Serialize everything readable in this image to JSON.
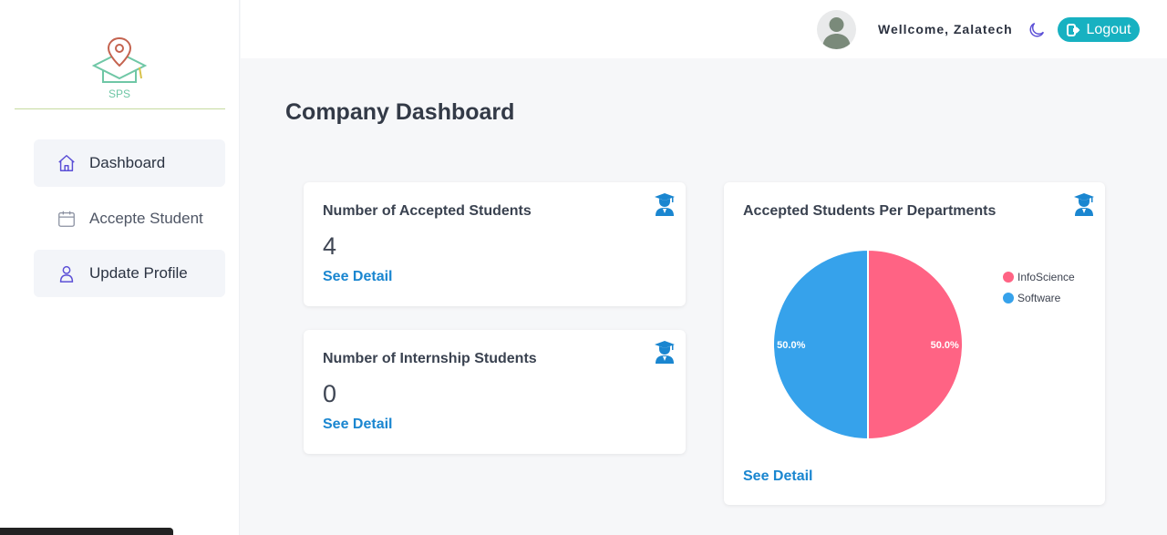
{
  "sidebar": {
    "logo_text": "SPS",
    "items": [
      {
        "label": "Dashboard",
        "icon": "home-icon"
      },
      {
        "label": "Accepte Student",
        "icon": "calendar-icon"
      },
      {
        "label": "Update Profile",
        "icon": "user-icon"
      }
    ]
  },
  "header": {
    "welcome": "Wellcome, Zalatech",
    "logout_label": "Logout",
    "theme_icon": "moon-icon"
  },
  "main": {
    "title": "Company Dashboard",
    "cards": [
      {
        "title": "Number of Accepted Students",
        "value": "4",
        "link": "See Detail",
        "icon": "graduate-icon"
      },
      {
        "title": "Number of Internship Students",
        "value": "0",
        "link": "See Detail",
        "icon": "graduate-icon"
      }
    ],
    "chart_card": {
      "title": "Accepted Students Per Departments",
      "link": "See Detail",
      "icon": "graduate-icon"
    }
  },
  "colors": {
    "accent": "#17b1c1",
    "link": "#1a86d0",
    "icon_blue": "#1a86d0",
    "pie_pink": "#ff6384",
    "pie_blue": "#36a2eb"
  },
  "chart_data": {
    "type": "pie",
    "title": "Accepted Students Per Departments",
    "categories": [
      "InfoScience",
      "Software"
    ],
    "values": [
      50.0,
      50.0
    ],
    "labels": [
      "50.0%",
      "50.0%"
    ],
    "colors": [
      "#ff6384",
      "#36a2eb"
    ],
    "legend": "right"
  }
}
